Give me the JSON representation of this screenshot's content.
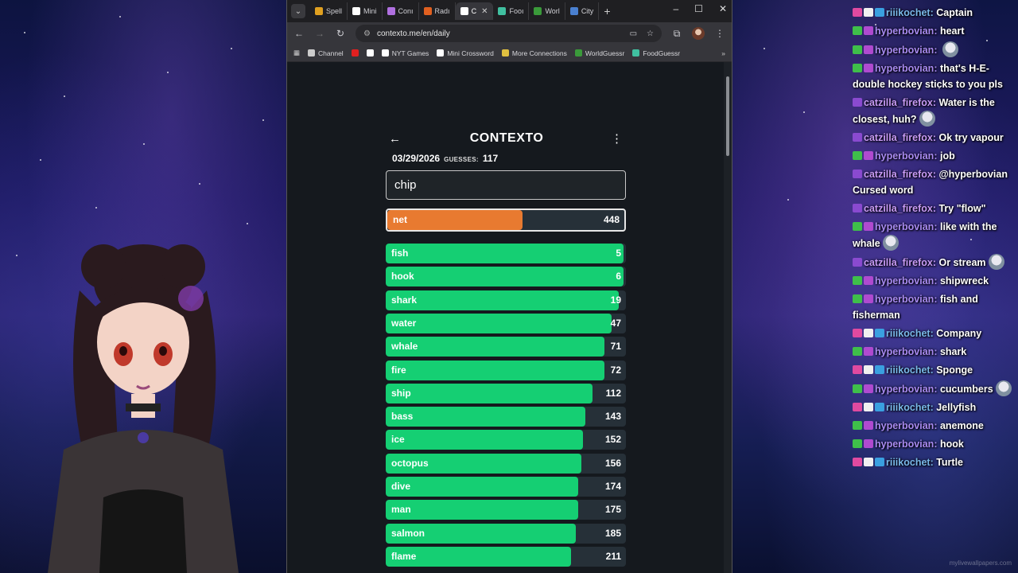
{
  "browser": {
    "tabs": [
      {
        "label": "Spell",
        "color": "#e0a020",
        "icon": "spell-icon"
      },
      {
        "label": "Mini",
        "color": "#ffffff",
        "icon": "nyt-icon"
      },
      {
        "label": "Conı",
        "color": "#b070e0",
        "icon": "connections-icon"
      },
      {
        "label": "Radı",
        "color": "#e06020",
        "icon": "radio-icon"
      },
      {
        "label": "C",
        "color": "#ffffff",
        "icon": "contexto-icon",
        "active": true
      },
      {
        "label": "Fooı",
        "color": "#40c0a0",
        "icon": "food-icon"
      },
      {
        "label": "Worl",
        "color": "#3a9a3a",
        "icon": "world-icon"
      },
      {
        "label": "City",
        "color": "#4a80d0",
        "icon": "globe-icon"
      }
    ],
    "url": "contexto.me/en/daily",
    "bookmarks": [
      {
        "label": "Channel",
        "icon": "folder-icon",
        "color": "#cccccc"
      },
      {
        "label": "",
        "icon": "youtube-icon",
        "color": "#e02020"
      },
      {
        "label": "",
        "icon": "x-icon",
        "color": "#ffffff"
      },
      {
        "label": "NYT Games",
        "icon": "nyt-icon",
        "color": "#ffffff"
      },
      {
        "label": "Mini Crossword",
        "icon": "nyt-icon",
        "color": "#ffffff"
      },
      {
        "label": "More Connections",
        "icon": "grid-icon",
        "color": "#e0c040"
      },
      {
        "label": "WorldGuessr",
        "icon": "world-icon",
        "color": "#3a9a3a"
      },
      {
        "label": "FoodGuessr",
        "icon": "food-icon",
        "color": "#40c0a0"
      }
    ]
  },
  "contexto": {
    "logo": "CONTEXTO",
    "date": "03/29/2026",
    "guesses_label": "GUESSES:",
    "guesses": "117",
    "input_value": "chip",
    "last_guess": {
      "word": "net",
      "rank": "448",
      "fill": 0.57,
      "color": "#e87a30"
    },
    "guesses_list": [
      {
        "word": "fish",
        "rank": "5",
        "fill": 0.99
      },
      {
        "word": "hook",
        "rank": "6",
        "fill": 0.99
      },
      {
        "word": "shark",
        "rank": "19",
        "fill": 0.97
      },
      {
        "word": "water",
        "rank": "47",
        "fill": 0.94
      },
      {
        "word": "whale",
        "rank": "71",
        "fill": 0.91
      },
      {
        "word": "fire",
        "rank": "72",
        "fill": 0.91
      },
      {
        "word": "ship",
        "rank": "112",
        "fill": 0.86
      },
      {
        "word": "bass",
        "rank": "143",
        "fill": 0.83
      },
      {
        "word": "ice",
        "rank": "152",
        "fill": 0.82
      },
      {
        "word": "octopus",
        "rank": "156",
        "fill": 0.815
      },
      {
        "word": "dive",
        "rank": "174",
        "fill": 0.8
      },
      {
        "word": "man",
        "rank": "175",
        "fill": 0.8
      },
      {
        "word": "salmon",
        "rank": "185",
        "fill": 0.79
      },
      {
        "word": "flame",
        "rank": "211",
        "fill": 0.77
      }
    ],
    "green": "#15cf73"
  },
  "chat": [
    {
      "user": "riiikochet",
      "color": "#79b8e8",
      "badges": [
        "#e04aa0",
        "#f0f0f0",
        "#3aa0e0"
      ],
      "text": "Captain"
    },
    {
      "user": "hyperbovian",
      "color": "#a98bf2",
      "badges": [
        "#3fbf4a",
        "#b04ad0"
      ],
      "text": "heart"
    },
    {
      "user": "hyperbovian",
      "color": "#a98bf2",
      "badges": [
        "#3fbf4a",
        "#b04ad0"
      ],
      "text": "",
      "emote": "crying-face-emote"
    },
    {
      "user": "hyperbovian",
      "color": "#a98bf2",
      "badges": [
        "#3fbf4a",
        "#b04ad0"
      ],
      "text": "that's H-E-double hockey sticks to you pls"
    },
    {
      "user": "catzilla_firefox",
      "color": "#c89bf5",
      "badges": [
        "#8a4ad0"
      ],
      "text": "Water is the closest, huh?",
      "emote": "anime-emote"
    },
    {
      "user": "catzilla_firefox",
      "color": "#c89bf5",
      "badges": [
        "#8a4ad0"
      ],
      "text": "Ok try vapour"
    },
    {
      "user": "hyperbovian",
      "color": "#a98bf2",
      "badges": [
        "#3fbf4a",
        "#b04ad0"
      ],
      "text": "job"
    },
    {
      "user": "catzilla_firefox",
      "color": "#c89bf5",
      "badges": [
        "#8a4ad0"
      ],
      "text": "@hyperbovian Cursed word"
    },
    {
      "user": "catzilla_firefox",
      "color": "#c89bf5",
      "badges": [
        "#8a4ad0"
      ],
      "text": "Try \"flow\""
    },
    {
      "user": "hyperbovian",
      "color": "#a98bf2",
      "badges": [
        "#3fbf4a",
        "#b04ad0"
      ],
      "text": "like with the whale",
      "emote": "face-emote"
    },
    {
      "user": "catzilla_firefox",
      "color": "#c89bf5",
      "badges": [
        "#8a4ad0"
      ],
      "text": "Or stream",
      "emote": "character-emote"
    },
    {
      "user": "hyperbovian",
      "color": "#a98bf2",
      "badges": [
        "#3fbf4a",
        "#b04ad0"
      ],
      "text": "shipwreck"
    },
    {
      "user": "hyperbovian",
      "color": "#a98bf2",
      "badges": [
        "#3fbf4a",
        "#b04ad0"
      ],
      "text": "fish and fisherman"
    },
    {
      "user": "riiikochet",
      "color": "#79b8e8",
      "badges": [
        "#e04aa0",
        "#f0f0f0",
        "#3aa0e0"
      ],
      "text": "Company"
    },
    {
      "user": "hyperbovian",
      "color": "#a98bf2",
      "badges": [
        "#3fbf4a",
        "#b04ad0"
      ],
      "text": "shark"
    },
    {
      "user": "riiikochet",
      "color": "#79b8e8",
      "badges": [
        "#e04aa0",
        "#f0f0f0",
        "#3aa0e0"
      ],
      "text": "Sponge"
    },
    {
      "user": "hyperbovian",
      "color": "#a98bf2",
      "badges": [
        "#3fbf4a",
        "#b04ad0"
      ],
      "text": "cucumbers",
      "emote": "face-emote"
    },
    {
      "user": "riiikochet",
      "color": "#79b8e8",
      "badges": [
        "#e04aa0",
        "#f0f0f0",
        "#3aa0e0"
      ],
      "text": "Jellyfish"
    },
    {
      "user": "hyperbovian",
      "color": "#a98bf2",
      "badges": [
        "#3fbf4a",
        "#b04ad0"
      ],
      "text": "anemone"
    },
    {
      "user": "hyperbovian",
      "color": "#a98bf2",
      "badges": [
        "#3fbf4a",
        "#b04ad0"
      ],
      "text": "hook"
    },
    {
      "user": "riiikochet",
      "color": "#79b8e8",
      "badges": [
        "#e04aa0",
        "#f0f0f0",
        "#3aa0e0"
      ],
      "text": "Turtle"
    }
  ],
  "watermark": "mylivewallpapers.com"
}
